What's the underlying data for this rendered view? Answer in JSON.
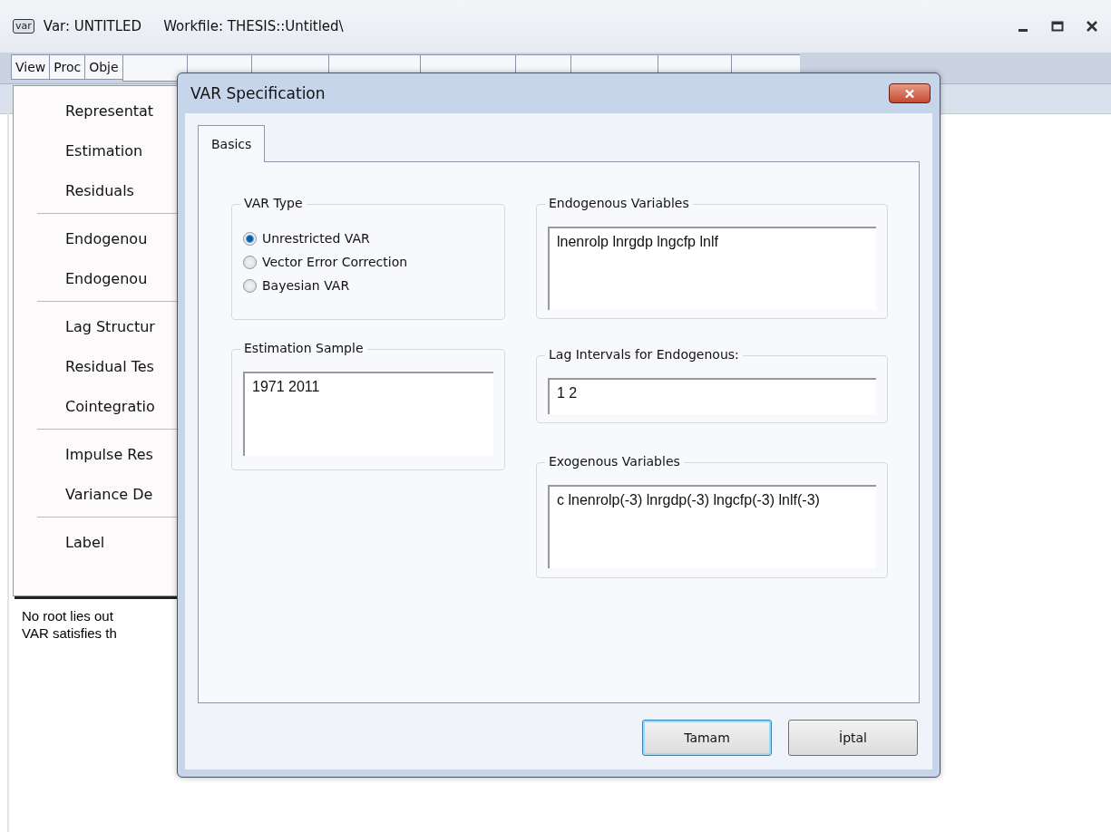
{
  "window": {
    "logo": "var",
    "object": "Var: UNTITLED",
    "workfile": "Workfile: THESIS::Untitled\\"
  },
  "toolbar": [
    {
      "label": "View"
    },
    {
      "label": "Proc"
    },
    {
      "label": "Obje"
    }
  ],
  "view_menu": [
    [
      "Representat",
      "Estimation",
      "Residuals"
    ],
    [
      "Endogenou",
      "Endogenou"
    ],
    [
      "Lag Structur",
      "Residual Tes",
      "Cointegratio"
    ],
    [
      "Impulse Res",
      "Variance De"
    ],
    [
      "Label"
    ]
  ],
  "output_lines": [
    "No root lies out",
    "VAR satisfies th"
  ],
  "dialog": {
    "title": "VAR Specification",
    "tabs": [
      {
        "label": "Basics",
        "selected": true
      }
    ],
    "var_type": {
      "label": "VAR Type",
      "options": [
        {
          "label": "Unrestricted VAR",
          "selected": true
        },
        {
          "label": "Vector Error Correction",
          "selected": false
        },
        {
          "label": "Bayesian VAR",
          "selected": false
        }
      ]
    },
    "estimation_sample": {
      "label": "Estimation Sample",
      "value": "1971 2011"
    },
    "endogenous": {
      "label": "Endogenous Variables",
      "value": "lnenrolp lnrgdp lngcfp lnlf"
    },
    "lag_intervals": {
      "label": "Lag Intervals for Endogenous:",
      "value": "1 2"
    },
    "exogenous": {
      "label": "Exogenous Variables",
      "value": "c lnenrolp(-3) lnrgdp(-3) lngcfp(-3) lnlf(-3)"
    },
    "buttons": [
      {
        "label": "Tamam",
        "default": true
      },
      {
        "label": "İptal",
        "default": false
      }
    ]
  }
}
